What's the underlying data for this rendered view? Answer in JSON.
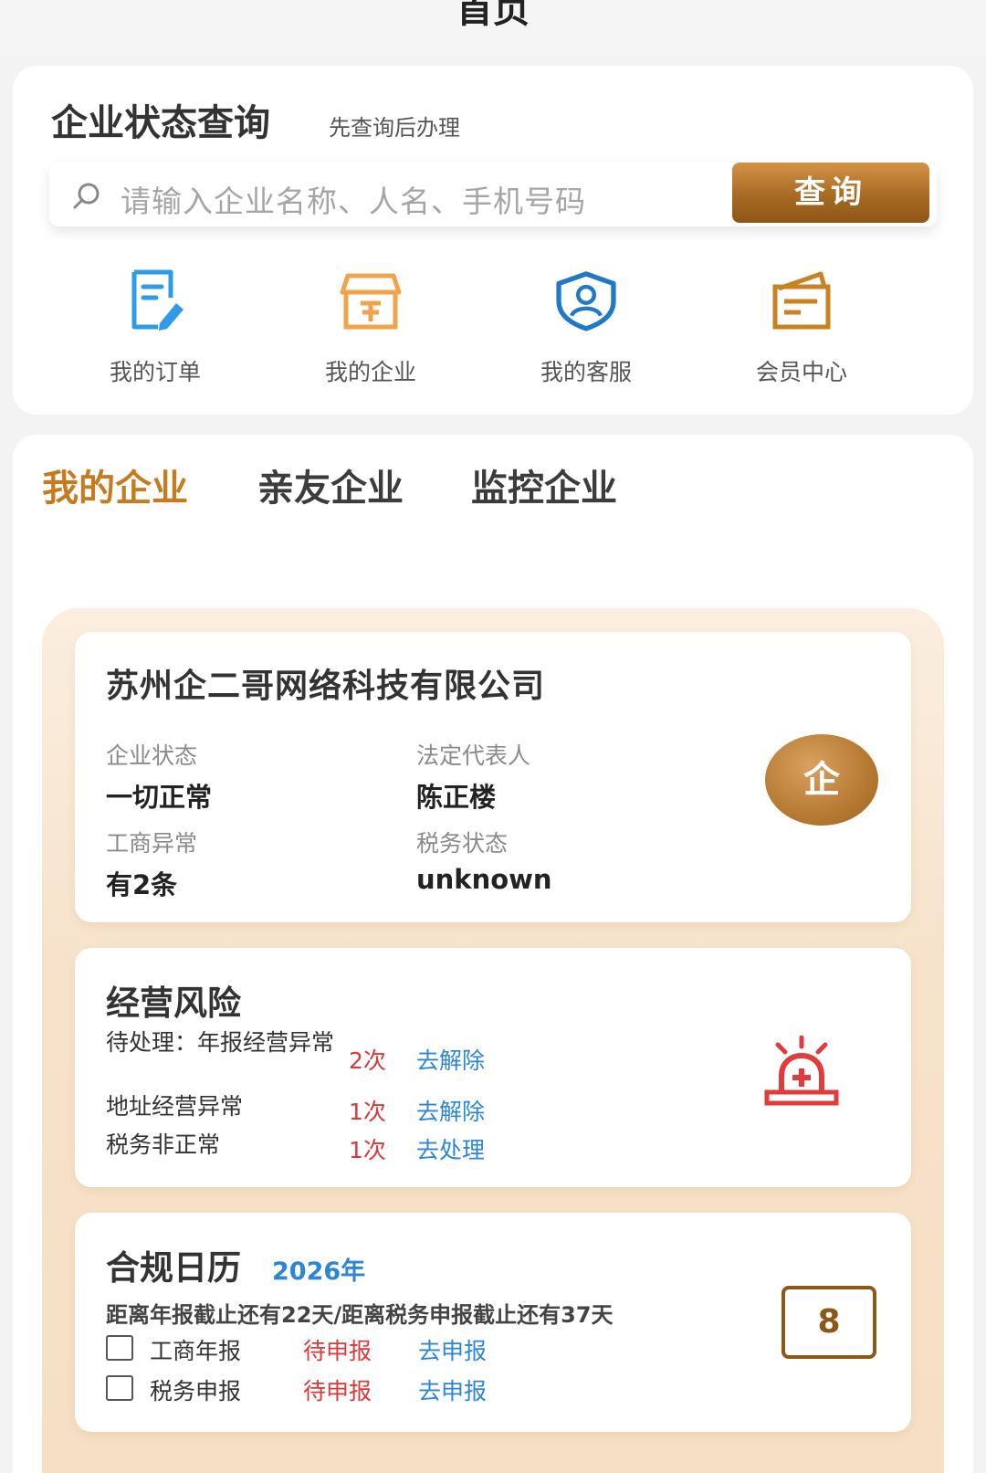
{
  "page": {
    "title": "首页"
  },
  "query_card": {
    "heading": "企业状态查询",
    "subheading": "先查询后办理",
    "search_placeholder": "请输入企业名称、人名、手机号码",
    "search_button": "查询",
    "quick_links": [
      {
        "label": "我的订单",
        "icon": "order-edit-icon",
        "color": "#2f9ae8"
      },
      {
        "label": "我的企业",
        "icon": "store-icon",
        "color": "#f0a349"
      },
      {
        "label": "我的客服",
        "icon": "service-shield-icon",
        "color": "#1f78c8"
      },
      {
        "label": "会员中心",
        "icon": "wallet-card-icon",
        "color": "#c98220"
      }
    ]
  },
  "tabs": [
    {
      "label": "我的企业",
      "active": true
    },
    {
      "label": "亲友企业",
      "active": false
    },
    {
      "label": "监控企业",
      "active": false
    }
  ],
  "company": {
    "name": "苏州企二哥网络科技有限公司",
    "badge": "企",
    "fields": [
      {
        "label": "企业状态",
        "value": "一切正常"
      },
      {
        "label": "法定代表人",
        "value": "陈正楼"
      },
      {
        "label": "工商异常",
        "value": "有2条"
      },
      {
        "label": "税务状态",
        "value": "unknown"
      }
    ]
  },
  "risk": {
    "title": "经营风险",
    "items": [
      {
        "name": "待处理：年报经营异常",
        "count": "2次",
        "action": "去解除"
      },
      {
        "name": "地址经营异常",
        "count": "1次",
        "action": "去解除"
      },
      {
        "name": "税务非正常",
        "count": "1次",
        "action": "去处理"
      }
    ],
    "icon": "alarm-siren-icon"
  },
  "calendar": {
    "title": "合规日历",
    "year": "2026年",
    "info": "距离年报截止还有22天/距离税务申报截止还有37天",
    "day": "8",
    "items": [
      {
        "name": "工商年报",
        "status": "待申报",
        "action": "去申报"
      },
      {
        "name": "税务申报",
        "status": "待申报",
        "action": "去申报"
      }
    ]
  },
  "colors": {
    "accent": "#c67c1e",
    "button": "#a86a24",
    "link": "#2c86d8",
    "alert": "#d83a3a"
  }
}
